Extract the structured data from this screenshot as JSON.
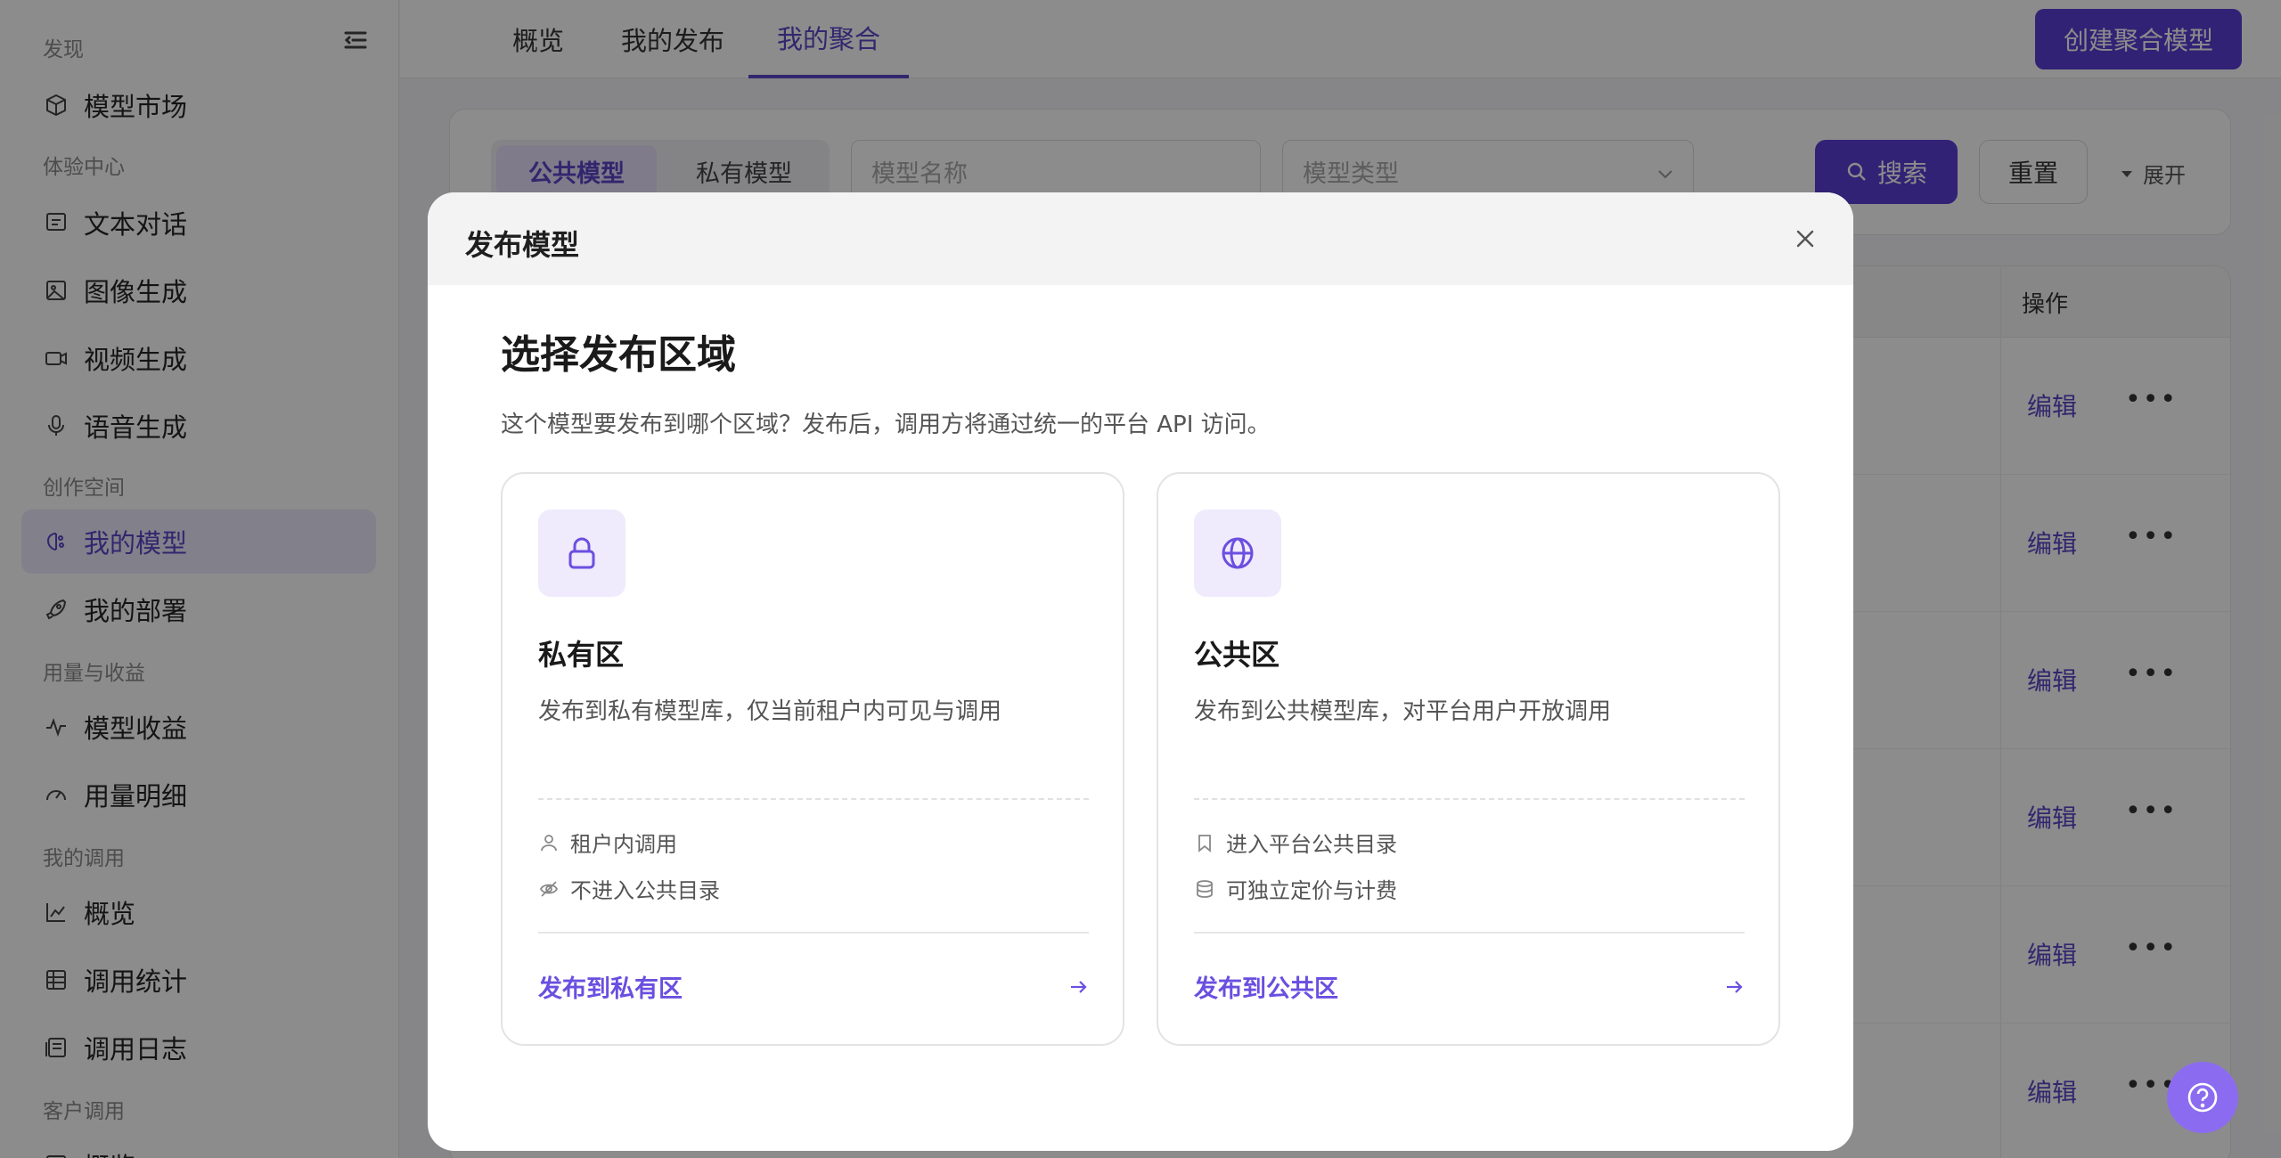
{
  "sidebar": {
    "sections": {
      "discover": "发现",
      "experience": "体验中心",
      "creation": "创作空间",
      "usage": "用量与收益",
      "my_calls": "我的调用",
      "customer_calls": "客户调用"
    },
    "items": [
      {
        "label": "模型市场",
        "icon": "cube-icon"
      },
      {
        "label": "文本对话",
        "icon": "chat-icon"
      },
      {
        "label": "图像生成",
        "icon": "image-icon"
      },
      {
        "label": "视频生成",
        "icon": "video-icon"
      },
      {
        "label": "语音生成",
        "icon": "mic-icon"
      },
      {
        "label": "我的模型",
        "icon": "brain-icon",
        "active": true
      },
      {
        "label": "我的部署",
        "icon": "rocket-icon"
      },
      {
        "label": "模型收益",
        "icon": "pulse-icon"
      },
      {
        "label": "用量明细",
        "icon": "gauge-icon"
      },
      {
        "label": "概览",
        "icon": "line-chart-icon"
      },
      {
        "label": "调用统计",
        "icon": "grid-icon"
      },
      {
        "label": "调用日志",
        "icon": "log-icon"
      },
      {
        "label": "概览",
        "icon": "overview-icon"
      }
    ]
  },
  "header": {
    "tabs": [
      {
        "label": "概览"
      },
      {
        "label": "我的发布"
      },
      {
        "label": "我的聚合",
        "active": true
      }
    ],
    "create_button": "创建聚合模型"
  },
  "filter": {
    "segments": [
      {
        "label": "公共模型",
        "active": true
      },
      {
        "label": "私有模型"
      }
    ],
    "name_placeholder": "模型名称",
    "type_placeholder": "模型类型",
    "search_button": "搜索",
    "reset_button": "重置",
    "expand_label": "展开"
  },
  "table": {
    "op_header": "操作",
    "rows": [
      {
        "edit": "编辑",
        "more": "•••"
      },
      {
        "edit": "编辑",
        "more": "•••"
      },
      {
        "edit": "编辑",
        "more": "•••"
      },
      {
        "edit": "编辑",
        "more": "•••"
      },
      {
        "edit": "编辑",
        "more": "•••"
      },
      {
        "edit": "编辑",
        "more": "•••"
      }
    ]
  },
  "modal": {
    "title": "发布模型",
    "heading": "选择发布区域",
    "subtitle": "这个模型要发布到哪个区域？发布后，调用方将通过统一的平台 API 访问。",
    "cards": [
      {
        "icon": "lock-icon",
        "title": "私有区",
        "desc": "发布到私有模型库，仅当前租户内可见与调用",
        "features": [
          {
            "icon": "user-icon",
            "text": "租户内调用"
          },
          {
            "icon": "eye-off-icon",
            "text": "不进入公共目录"
          }
        ],
        "action": "发布到私有区"
      },
      {
        "icon": "globe-icon",
        "title": "公共区",
        "desc": "发布到公共模型库，对平台用户开放调用",
        "features": [
          {
            "icon": "bookmark-icon",
            "text": "进入平台公共目录"
          },
          {
            "icon": "coins-icon",
            "text": "可独立定价与计费"
          }
        ],
        "action": "发布到公共区"
      }
    ]
  },
  "colors": {
    "primary": "#5a3fd6",
    "accent_text": "#6a4fe0",
    "active_bg": "#ede9fb",
    "overlay": "rgba(0,0,0,0.45)"
  }
}
